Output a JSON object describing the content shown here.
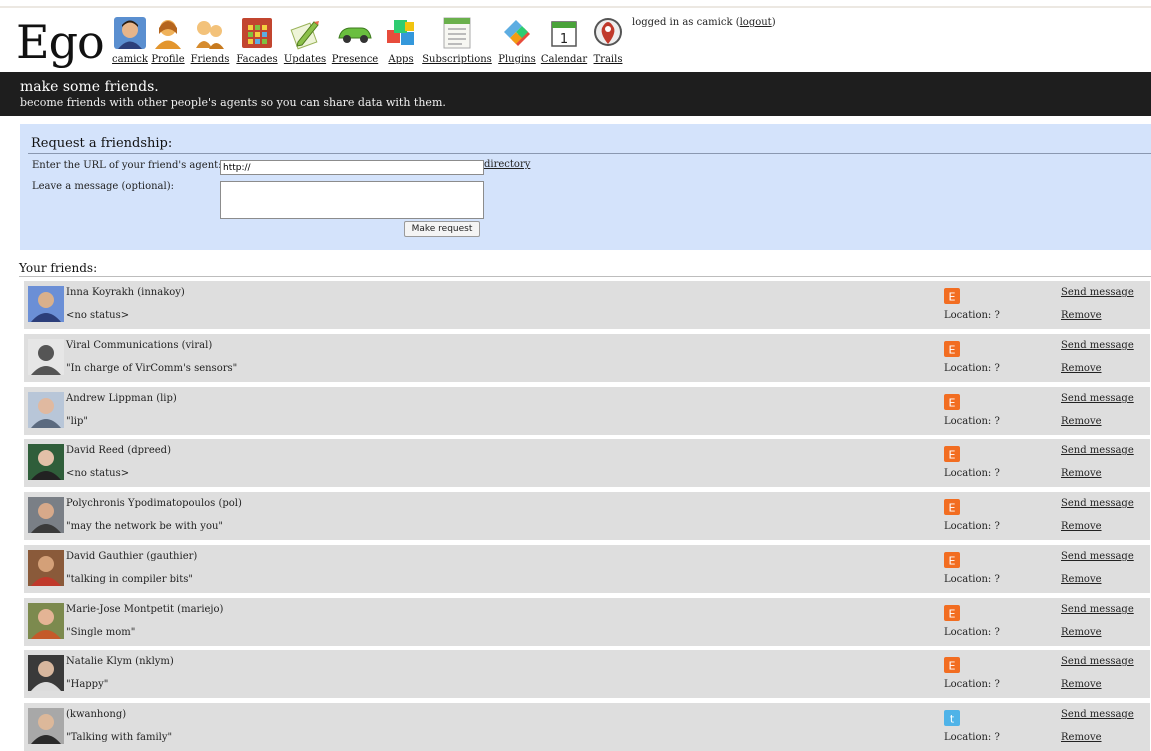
{
  "app": {
    "logo": "Ego"
  },
  "nav": [
    {
      "label": "camick",
      "icon": "user-avatar-icon"
    },
    {
      "label": "Profile",
      "icon": "profile-person-icon"
    },
    {
      "label": "Friends",
      "icon": "friends-people-icon"
    },
    {
      "label": "Facades",
      "icon": "facades-grid-icon"
    },
    {
      "label": "Updates",
      "icon": "pencil-notepad-icon"
    },
    {
      "label": "Presence",
      "icon": "presence-car-icon"
    },
    {
      "label": "Apps",
      "icon": "apps-cubes-icon"
    },
    {
      "label": "Subscriptions",
      "icon": "subscriptions-document-icon"
    },
    {
      "label": "Plugins",
      "icon": "plugins-puzzle-icon"
    },
    {
      "label": "Calendar",
      "icon": "calendar-icon"
    },
    {
      "label": "Trails",
      "icon": "map-pin-icon"
    }
  ],
  "session": {
    "prefix": "logged in as camick (",
    "logout": "logout",
    "suffix": ")"
  },
  "banner": {
    "title": "make some friends.",
    "subtitle": "become friends with other people's agents so you can share data with them."
  },
  "request": {
    "title": "Request a friendship:",
    "url_label": "Enter the URL of your friend's agent:",
    "url_value": "http://",
    "directory_link": "directory",
    "message_label": "Leave a message (optional):",
    "submit_label": "Make request"
  },
  "friends": {
    "title": "Your friends:",
    "location_label": "Location: ?",
    "send_label": "Send message",
    "remove_label": "Remove",
    "items": [
      {
        "name": "Inna Koyrakh (innakoy)",
        "status": "<no status>",
        "badge": "E",
        "badge_color": "#f26d21"
      },
      {
        "name": "Viral Communications (viral)",
        "status": "\"In charge of VirComm's sensors\"",
        "badge": "E",
        "badge_color": "#f26d21"
      },
      {
        "name": "Andrew Lippman (lip)",
        "status": "\"lip\"",
        "badge": "E",
        "badge_color": "#f26d21"
      },
      {
        "name": "David Reed (dpreed)",
        "status": "<no status>",
        "badge": "E",
        "badge_color": "#f26d21"
      },
      {
        "name": "Polychronis Ypodimatopoulos (pol)",
        "status": "\"may the network be with you\"",
        "badge": "E",
        "badge_color": "#f26d21"
      },
      {
        "name": "David Gauthier (gauthier)",
        "status": "\"talking in compiler bits\"",
        "badge": "E",
        "badge_color": "#f26d21"
      },
      {
        "name": "Marie-Jose Montpetit (mariejo)",
        "status": "\"Single mom\"",
        "badge": "E",
        "badge_color": "#f26d21"
      },
      {
        "name": "Natalie Klym (nklym)",
        "status": "\"Happy\"",
        "badge": "E",
        "badge_color": "#f26d21"
      },
      {
        "name": "(kwanhong)",
        "status": "\"Talking with family\"",
        "badge": "t",
        "badge_color": "#4fb3e8"
      }
    ]
  }
}
